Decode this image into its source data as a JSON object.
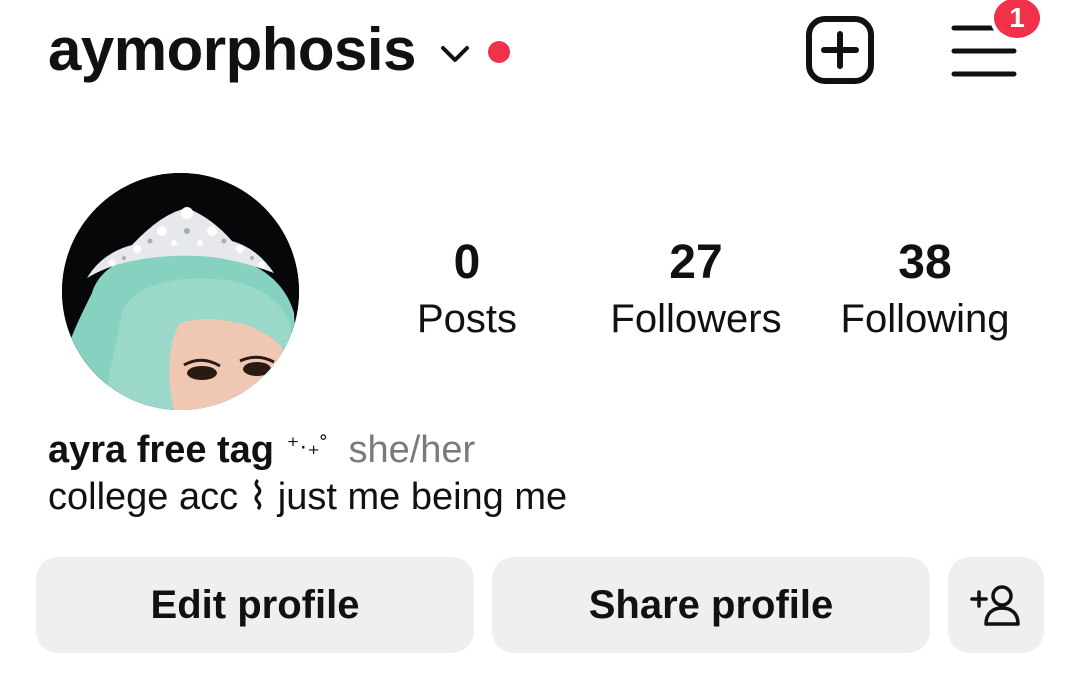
{
  "header": {
    "username": "aymorphosis",
    "menu_badge_count": "1",
    "live_dot_color": "#f1304a",
    "icons": {
      "switch_account": "chevron-down-icon",
      "create": "plus-square-icon",
      "menu": "hamburger-menu-icon"
    }
  },
  "stats": [
    {
      "count": "0",
      "label": "Posts"
    },
    {
      "count": "27",
      "label": "Followers"
    },
    {
      "count": "38",
      "label": "Following"
    }
  ],
  "bio": {
    "name": "ayra free tag",
    "decoration": "⁺·₊˚",
    "pronouns": "she/her",
    "text": "college acc ⌇ just me being me"
  },
  "buttons": {
    "edit_profile": "Edit profile",
    "share_profile": "Share profile",
    "add_person_icon": "person-add-icon"
  },
  "colors": {
    "accent_red": "#f1304a",
    "button_bg": "#efefef",
    "secondary_text": "#7a7a7a"
  }
}
